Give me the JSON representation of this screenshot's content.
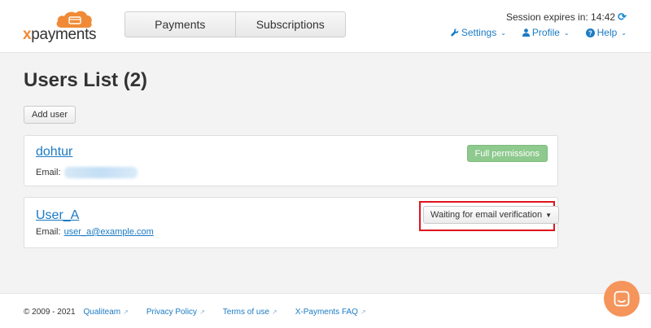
{
  "header": {
    "logo_text_x": "x",
    "logo_text_rest": "payments",
    "tabs": [
      {
        "label": "Payments"
      },
      {
        "label": "Subscriptions"
      }
    ],
    "session_label": "Session expires in: 14:42",
    "nav": {
      "settings": "Settings",
      "profile": "Profile",
      "help": "Help"
    }
  },
  "main": {
    "title": "Users List (2)",
    "add_user_label": "Add user",
    "users": [
      {
        "name": "dohtur",
        "email_label": "Email:",
        "email": "",
        "badge": "Full permissions"
      },
      {
        "name": "User_A",
        "email_label": "Email:",
        "email": "user_a@example.com",
        "status_button": "Waiting for email verification"
      }
    ]
  },
  "footer": {
    "copyright": "© 2009 - 2021",
    "links": [
      "Qualiteam",
      "Privacy Policy",
      "Terms of use",
      "X-Payments FAQ"
    ]
  },
  "colors": {
    "link": "#1b7bc4",
    "brand_orange": "#f08a36",
    "success_badge": "#8ec98e",
    "highlight_red": "#e0141c",
    "chat_bubble": "#f5955b"
  },
  "icons": {
    "settings": "wrench-icon",
    "profile": "user-icon",
    "help": "question-circle-icon",
    "session": "refresh-icon",
    "footer_links": "external-link-icon",
    "chat": "chat-icon"
  }
}
